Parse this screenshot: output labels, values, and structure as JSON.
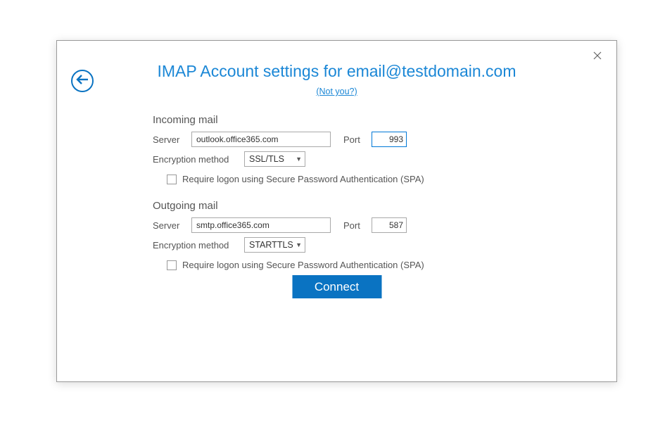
{
  "title": "IMAP Account settings for email@testdomain.com",
  "not_you": "(Not you?)",
  "incoming": {
    "heading": "Incoming mail",
    "server_label": "Server",
    "server_value": "outlook.office365.com",
    "port_label": "Port",
    "port_value": "993",
    "enc_label": "Encryption method",
    "enc_value": "SSL/TLS",
    "spa_label": "Require logon using Secure Password Authentication (SPA)"
  },
  "outgoing": {
    "heading": "Outgoing mail",
    "server_label": "Server",
    "server_value": "smtp.office365.com",
    "port_label": "Port",
    "port_value": "587",
    "enc_label": "Encryption method",
    "enc_value": "STARTTLS",
    "spa_label": "Require logon using Secure Password Authentication (SPA)"
  },
  "connect_label": "Connect"
}
